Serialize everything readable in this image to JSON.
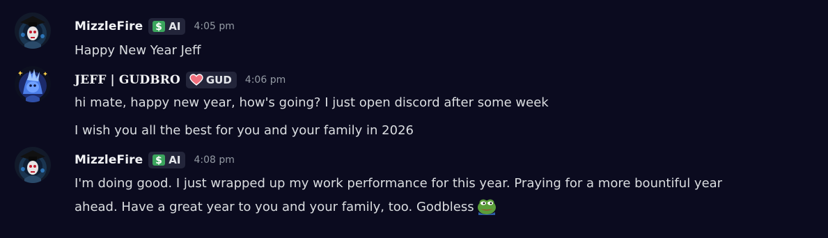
{
  "messages": [
    {
      "username": "MizzleFire",
      "tag": "AI",
      "tag_icon": "dollar-sign-icon",
      "timestamp": "4:05 pm",
      "lines": [
        "Happy New Year Jeff"
      ]
    },
    {
      "username": "JEFF | GUDBRO",
      "tag": "GUD",
      "tag_icon": "heart-icon",
      "timestamp": "4:06 pm",
      "lines": [
        "hi mate, happy new year, how's going? I just open discord after some week",
        "I wish you all the best for you and your family in 2026"
      ]
    },
    {
      "username": "MizzleFire",
      "tag": "AI",
      "tag_icon": "dollar-sign-icon",
      "timestamp": "4:08 pm",
      "lines": [
        "I'm doing good. I just wrapped up my work performance for this year. Praying for a more bountiful year",
        "ahead. Have a great year to you and your family, too. Godbless"
      ],
      "emoji": "pepe-frog-emoji"
    }
  ],
  "colors": {
    "background": "#0b0b1f",
    "username": "#f2f3f5",
    "text": "#dbdee1",
    "timestamp": "#949ba4",
    "tag_background": "#23253a"
  }
}
